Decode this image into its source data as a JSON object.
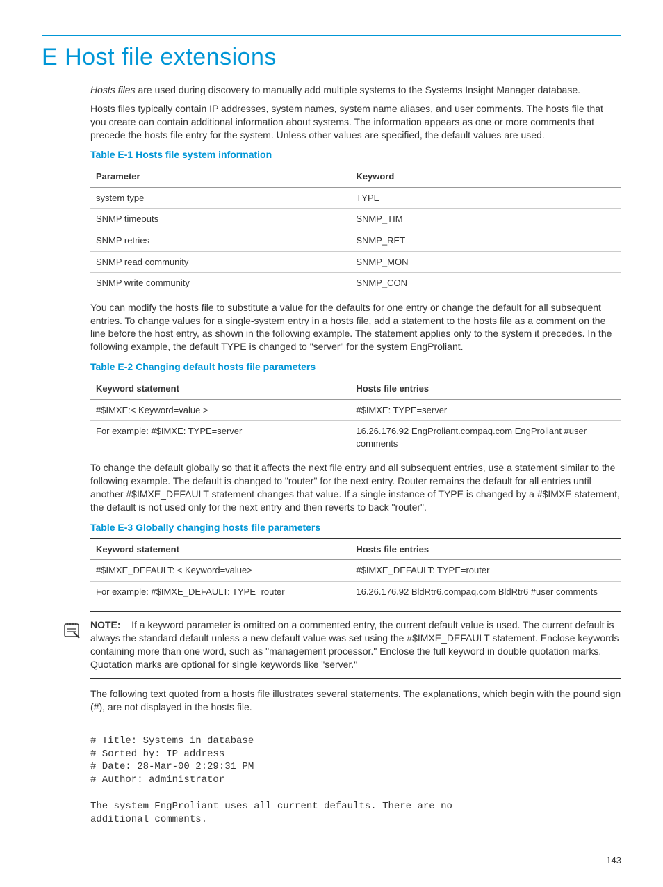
{
  "title": "E Host file extensions",
  "intro1_italic": "Hosts files",
  "intro1_rest": " are used during discovery to manually add multiple systems to the Systems Insight Manager database.",
  "intro2": "Hosts files typically contain IP addresses, system names, system name aliases, and user comments. The hosts file that you create can contain additional information about systems. The information appears as one or more comments that precede the hosts file entry for the system. Unless other values are specified, the default values are used.",
  "table1": {
    "caption": "Table E-1 Hosts file system information",
    "headers": [
      "Parameter",
      "Keyword"
    ],
    "rows": [
      [
        "system type",
        "TYPE"
      ],
      [
        "SNMP timeouts",
        "SNMP_TIM"
      ],
      [
        "SNMP retries",
        "SNMP_RET"
      ],
      [
        "SNMP read community",
        "SNMP_MON"
      ],
      [
        "SNMP write community",
        "SNMP_CON"
      ]
    ]
  },
  "para_after_t1": "You can modify the hosts file to substitute a value for the defaults for one entry or change the default for all subsequent entries. To change values for a single-system entry in a hosts file, add a statement to the hosts file as a comment on the line before the host entry, as shown in the following example. The statement applies only to the system it precedes. In the following example, the default TYPE is changed to \"server\" for the system EngProliant.",
  "table2": {
    "caption": "Table E-2 Changing default hosts file parameters",
    "headers": [
      "Keyword statement",
      "Hosts file entries"
    ],
    "rows": [
      [
        "#$IMXE:< Keyword=value >",
        "#$IMXE: TYPE=server"
      ],
      [
        "For example: #$IMXE: TYPE=server",
        "16.26.176.92 EngProliant.compaq.com EngProliant #user comments"
      ]
    ]
  },
  "para_after_t2": "To change the default globally so that it affects the next file entry and all subsequent entries, use a statement similar to the following example. The default is changed to \"router\" for the next entry. Router remains the default for all entries until another #$IMXE_DEFAULT statement changes that value. If a single instance of TYPE is changed by a #$IMXE statement, the default is not used only for the next entry and then reverts to back \"router\".",
  "table3": {
    "caption": "Table E-3 Globally changing hosts file parameters",
    "headers": [
      "Keyword statement",
      "Hosts file entries"
    ],
    "rows": [
      [
        "#$IMXE_DEFAULT: < Keyword=value>",
        "#$IMXE_DEFAULT: TYPE=router"
      ],
      [
        "For example: #$IMXE_DEFAULT: TYPE=router",
        "16.26.176.92 BldRtr6.compaq.com BldRtr6 #user comments"
      ]
    ]
  },
  "note_label": "NOTE:",
  "note_text": "If a keyword parameter is omitted on a commented entry, the current default value is used. The current default is always the standard default unless a new default value was set using the #$IMXE_DEFAULT statement. Enclose keywords containing more than one word, such as \"management processor.\" Enclose the full keyword in double quotation marks. Quotation marks are optional for single keywords like \"server.\"",
  "para_after_note": "The following text quoted from a hosts file illustrates several statements. The explanations, which begin with the pound sign (#), are not displayed in the hosts file.",
  "code_block": "# Title: Systems in database\n# Sorted by: IP address\n# Date: 28-Mar-00 2:29:31 PM\n# Author: administrator\n\nThe system EngProliant uses all current defaults. There are no\nadditional comments.",
  "page_number": "143"
}
